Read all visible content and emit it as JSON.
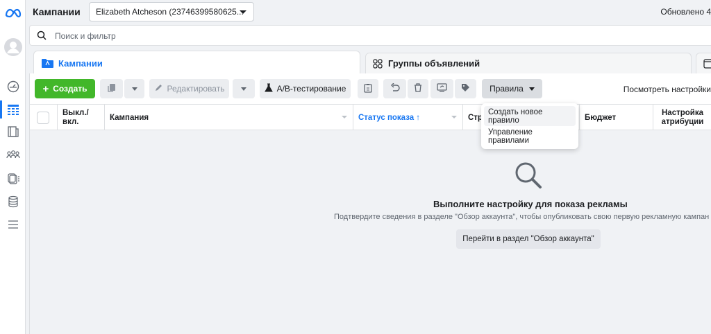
{
  "rail": {
    "logo_icon": "meta-logo-icon",
    "items": [
      "overview-icon",
      "campaigns-table-icon",
      "pages-icon",
      "audiences-icon",
      "catalog-icon",
      "billing-icon",
      "menu-icon"
    ]
  },
  "header": {
    "title": "Кампании",
    "account_selector": "Elizabeth Atcheson (23746399580625...",
    "updated": "Обновлено 4"
  },
  "search": {
    "placeholder": "Поиск и фильтр"
  },
  "tabs": [
    {
      "label": "Кампании",
      "active": true
    },
    {
      "label": "Группы объявлений",
      "active": false
    }
  ],
  "toolbar": {
    "create": "Создать",
    "edit": "Редактировать",
    "ab_test": "A/B-тестирование",
    "rules": "Правила",
    "view_settings": "Посмотреть настройки"
  },
  "table": {
    "columns": [
      "Выкл./ вкл.",
      "Кампания",
      "Статус показа",
      "Стр",
      "Бюджет",
      "Настройка атрибуции"
    ],
    "sort_arrow": "↑"
  },
  "rules_menu": {
    "items": [
      "Создать новое правило",
      "Управление правилами"
    ]
  },
  "empty_state": {
    "title": "Выполните настройку для показа рекламы",
    "subtitle": "Подтвердите сведения в разделе \"Обзор аккаунта\", чтобы опубликовать свою первую рекламную кампан",
    "button": "Перейти в раздел \"Обзор аккаунта\""
  },
  "colors": {
    "accent": "#1877f2",
    "create": "#42b72a",
    "background": "#f0f2f5"
  }
}
